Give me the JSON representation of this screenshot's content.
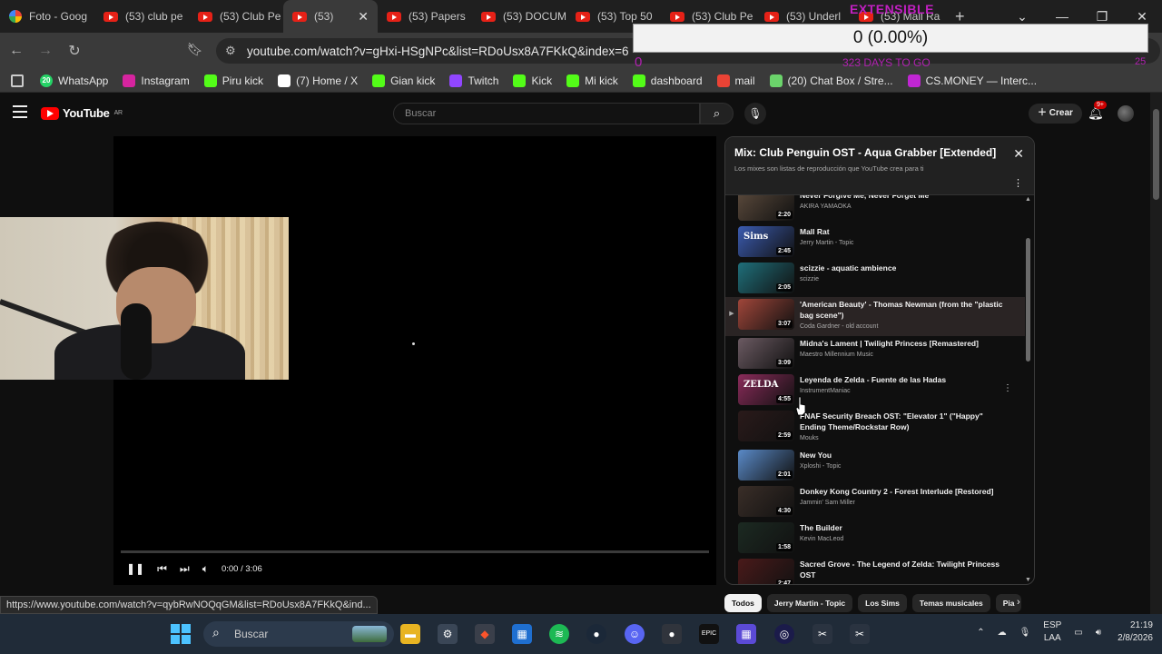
{
  "browser": {
    "tabs": [
      {
        "label": "Foto - Goog",
        "favicon": "photos-icon"
      },
      {
        "label": "(53) club pe",
        "favicon": "youtube-icon"
      },
      {
        "label": "(53) Club Pe",
        "favicon": "youtube-icon"
      },
      {
        "label": "(53)",
        "favicon": "youtube-icon",
        "active": true
      },
      {
        "label": "(53) Papers",
        "favicon": "youtube-icon"
      },
      {
        "label": "(53) DOCUM",
        "favicon": "youtube-icon"
      },
      {
        "label": "(53) Top 50",
        "favicon": "youtube-icon"
      },
      {
        "label": "(53) Club Pe",
        "favicon": "youtube-icon"
      },
      {
        "label": "(53) Underl",
        "favicon": "youtube-icon"
      },
      {
        "label": "(53) Mall Ra",
        "favicon": "youtube-icon"
      }
    ],
    "url": "youtube.com/watch?v=gHxi-HSgNPc&list=RDoUsx8A7FKkQ&index=6",
    "bookmarks": [
      {
        "label": "WhatsApp",
        "badge": "20",
        "color": "#25d366"
      },
      {
        "label": "Instagram",
        "color": "#d6249f"
      },
      {
        "label": "Piru kick",
        "color": "#53fc18"
      },
      {
        "label": "(7) Home / X",
        "color": "#ffffff"
      },
      {
        "label": "Gian kick",
        "color": "#53fc18"
      },
      {
        "label": "Twitch",
        "color": "#9146ff"
      },
      {
        "label": "Kick",
        "color": "#53fc18"
      },
      {
        "label": "Mi kick",
        "color": "#53fc18"
      },
      {
        "label": "dashboard",
        "color": "#53fc18"
      },
      {
        "label": "mail",
        "color": "#ea4335"
      },
      {
        "label": "(20) Chat Box / Stre...",
        "color": "#6bd46b"
      },
      {
        "label": "CS.MONEY — Interc...",
        "color": "#c026d3"
      }
    ],
    "status_url": "https://www.youtube.com/watch?v=qybRwNOQqGM&list=RDoUsx8A7FKkQ&ind..."
  },
  "overlay": {
    "title": "EXTENSIBLE",
    "value": "0 (0.00%)",
    "days": "323 DAYS TO GO",
    "left_num": "0",
    "right_num": "25"
  },
  "youtube": {
    "logo_text": "YouTube",
    "region": "AR",
    "search_placeholder": "Buscar",
    "create_label": "Crear",
    "notif_badge": "9+",
    "player": {
      "time": "0:00 / 3:06",
      "progress": 0.0
    },
    "mix": {
      "title": "Mix: Club Penguin OST - Aqua Grabber [Extended]",
      "subtitle": "Los mixes son listas de reproducción que YouTube crea para ti",
      "items": [
        {
          "title": "Never Forgive Me, Never Forget Me",
          "channel": "AKIRA YAMAOKA",
          "duration": "2:20",
          "thumb": "#5b4a3c"
        },
        {
          "title": "Mall Rat",
          "channel": "Jerry Martin - Topic",
          "duration": "2:45",
          "thumb": "#3b5bb0",
          "thumb_text": "Sims"
        },
        {
          "title": "scizzie - aquatic ambience",
          "channel": "scizzie",
          "duration": "2:05",
          "thumb": "#1f6f7a"
        },
        {
          "title": "'American Beauty' - Thomas Newman (from the \"plastic bag scene\")",
          "channel": "Coda Gardner - old account",
          "duration": "3:07",
          "thumb": "#a0463a",
          "current": true
        },
        {
          "title": "Midna's Lament | Twilight Princess [Remastered]",
          "channel": "Maestro Millennium Music",
          "duration": "3:09",
          "thumb": "#6b5a62"
        },
        {
          "title": "Leyenda de Zelda - Fuente de las Hadas",
          "channel": "InstrumentManiac",
          "duration": "4:55",
          "thumb": "#8a2b5a",
          "thumb_text": "ZELDA"
        },
        {
          "title": "FNAF Security Breach OST: \"Elevator 1\" (\"Happy\" Ending Theme/Rockstar Row)",
          "channel": "Mouks",
          "duration": "2:59",
          "thumb": "#2a1a1a"
        },
        {
          "title": "New You",
          "channel": "Xploshi - Topic",
          "duration": "2:01",
          "thumb": "#5a8ac8"
        },
        {
          "title": "Donkey Kong Country 2 - Forest Interlude [Restored]",
          "channel": "Jammin' Sam Miller",
          "duration": "4:30",
          "thumb": "#3a2e28"
        },
        {
          "title": "The Builder",
          "channel": "Kevin MacLeod",
          "duration": "1:58",
          "thumb": "#1c2a22"
        },
        {
          "title": "Sacred Grove - The Legend of Zelda: Twilight Princess OST",
          "channel": "",
          "duration": "2:47",
          "thumb": "#4a1a1a"
        }
      ]
    },
    "chips": [
      "Todos",
      "Jerry Martin - Topic",
      "Los Sims",
      "Temas musicales",
      "Pia"
    ]
  },
  "taskbar": {
    "search_placeholder": "Buscar",
    "lang": "ESP",
    "layout": "LAA",
    "time": "21:19",
    "date": "2/8/2026"
  }
}
